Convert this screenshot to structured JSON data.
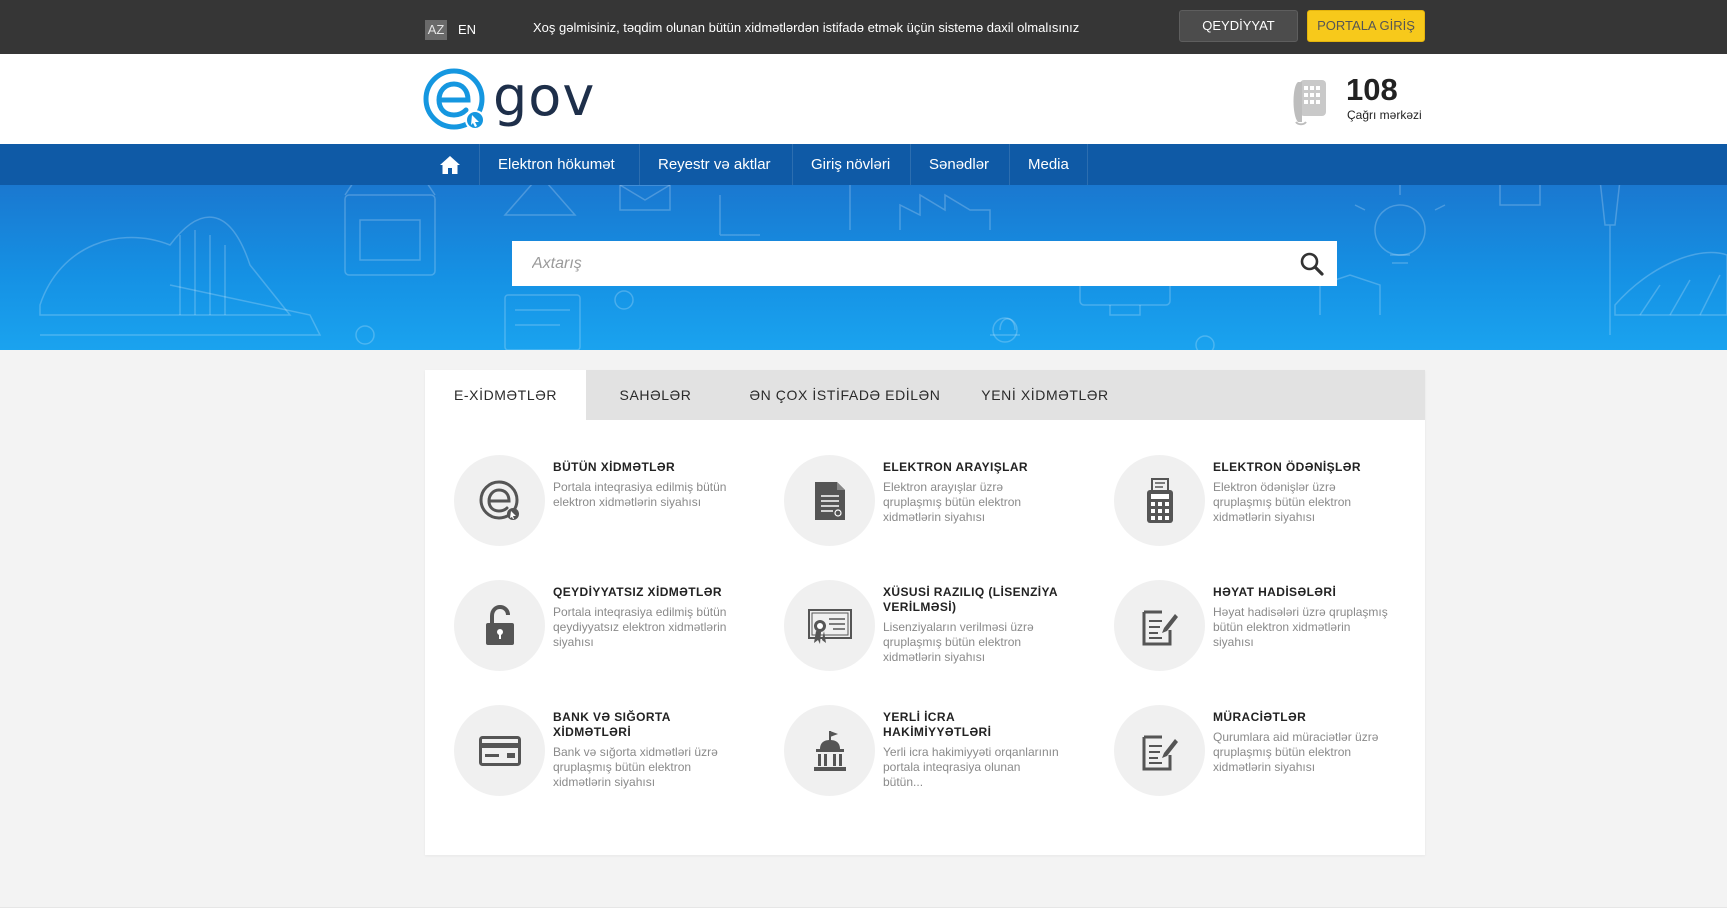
{
  "topbar": {
    "lang_az": "AZ",
    "lang_en": "EN",
    "welcome": "Xoş gəlmisiniz, təqdim olunan bütün xidmətlərdən istifadə etmək üçün sistemə daxil olmalısınız",
    "register": "QEYDİYYAT",
    "login": "PORTALA GİRİŞ"
  },
  "header": {
    "logo_text": "gov",
    "call_number": "108",
    "call_label": "Çağrı mərkəzi"
  },
  "nav": {
    "items": [
      "Elektron hökumət",
      "Reyestr və aktlar",
      "Giriş növləri",
      "Sənədlər",
      "Media"
    ]
  },
  "search": {
    "placeholder": "Axtarış"
  },
  "tabs": [
    "E-XİDMƏTLƏR",
    "SAHƏLƏR",
    "ƏN ÇOX İSTİFADƏ EDİLƏN",
    "YENİ XİDMƏTLƏR"
  ],
  "services": [
    {
      "title": "BÜTÜN XİDMƏTLƏR",
      "desc": "Portala inteqrasiya edilmiş bütün elektron xidmətlərin siyahısı",
      "icon": "egov-icon"
    },
    {
      "title": "ELEKTRON ARAYIŞLAR",
      "desc": "Elektron arayışlar üzrə qruplaşmış bütün elektron xidmətlərin siyahısı",
      "icon": "document-icon"
    },
    {
      "title": "ELEKTRON ÖDƏNİŞLƏR",
      "desc": "Elektron ödənişlər üzrə qruplaşmış bütün elektron xidmətlərin siyahısı",
      "icon": "calculator-icon"
    },
    {
      "title": "QEYDİYYATSIZ XİDMƏTLƏR",
      "desc": "Portala inteqrasiya edilmiş bütün qeydiyyatsız elektron xidmətlərin siyahısı",
      "icon": "unlock-icon"
    },
    {
      "title": "XÜSUSİ RAZILIQ (LİSENZİYA VERİLMƏSİ)",
      "desc": "Lisenziyaların verilməsi üzrə qruplaşmış bütün elektron xidmətlərin siyahısı",
      "icon": "certificate-icon"
    },
    {
      "title": "HƏYAT HADİSƏLƏRİ",
      "desc": "Həyat hadisələri üzrə qruplaşmış bütün elektron xidmətlərin siyahısı",
      "icon": "edit-document-icon"
    },
    {
      "title": "BANK VƏ SIĞORTA XİDMƏTLƏRİ",
      "desc": "Bank və sığorta xidmətləri üzrə qruplaşmış bütün elektron xidmətlərin siyahısı",
      "icon": "credit-card-icon"
    },
    {
      "title": "YERLİ İCRA HAKİMİYYƏTLƏRİ",
      "desc": "Yerli icra hakimiyyəti orqanlarının portala inteqrasiya olunan bütün...",
      "icon": "government-building-icon"
    },
    {
      "title": "MÜRACİƏTLƏR",
      "desc": "Qurumlara aid müraciətlər üzrə qruplaşmış bütün elektron xidmətlərin siyahısı",
      "icon": "edit-document-icon"
    }
  ]
}
